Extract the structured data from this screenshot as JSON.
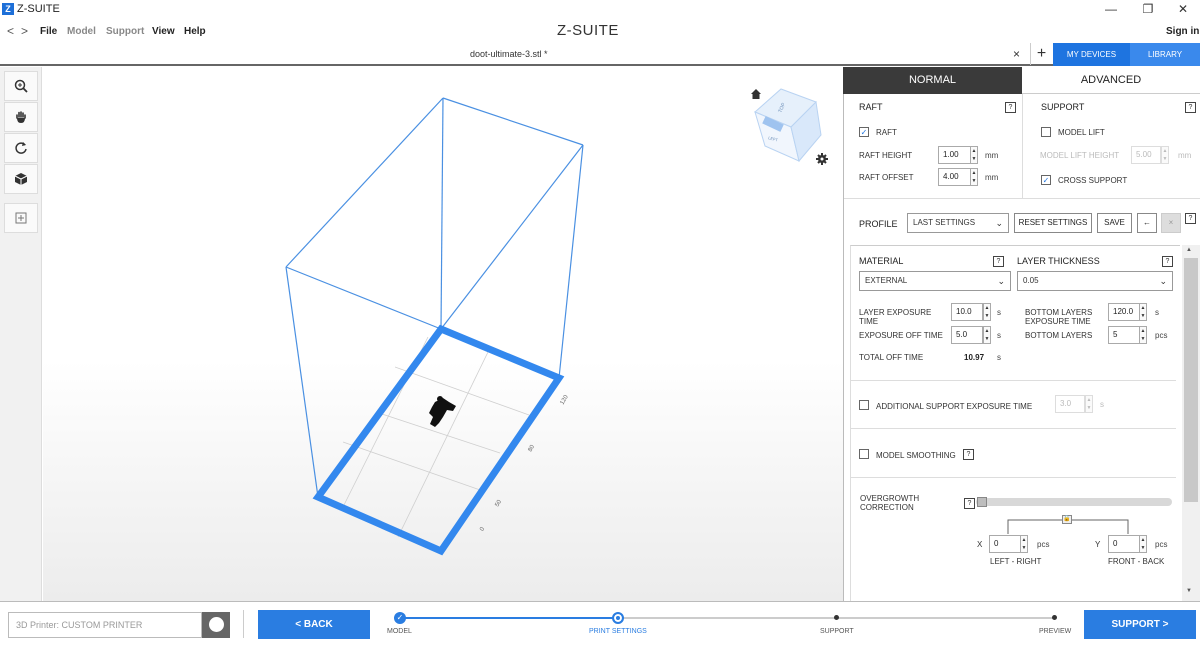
{
  "window": {
    "app_title": "Z-SUITE",
    "logo_letter": "Z",
    "minimize": "—",
    "maximize": "❐",
    "close": "✕"
  },
  "menu": {
    "back": "<",
    "forward": ">",
    "items": [
      "File",
      "Model",
      "Support",
      "View",
      "Help"
    ],
    "brand": "Z-SUITE",
    "sign_in": "Sign in"
  },
  "tabs": {
    "file_name": "doot-ultimate-3.stl *",
    "close": "×",
    "add": "+",
    "my_devices": "MY DEVICES",
    "library": "LIBRARY"
  },
  "toolbar": {
    "icons": [
      "zoom-icon",
      "hand-icon",
      "rotate-icon",
      "cube-icon",
      "add-view-icon"
    ]
  },
  "viewport": {
    "home_icon": "home-icon",
    "settings_icon": "gear-icon",
    "cube_labels": {
      "top": "TOP",
      "left": "LEFT"
    },
    "scale_labels": [
      "0",
      "50",
      "80",
      "120"
    ]
  },
  "panel": {
    "tab_normal": "NORMAL",
    "tab_advanced": "ADVANCED",
    "raft": {
      "title": "RAFT",
      "help": "?",
      "raft_label": "RAFT",
      "raft_checked": true,
      "height_label": "RAFT HEIGHT",
      "height_value": "1.00",
      "height_unit": "mm",
      "offset_label": "RAFT OFFSET",
      "offset_value": "4.00",
      "offset_unit": "mm"
    },
    "support": {
      "title": "SUPPORT",
      "help": "?",
      "model_lift_label": "MODEL LIFT",
      "model_lift_checked": false,
      "lift_height_label": "MODEL LIFT HEIGHT",
      "lift_height_value": "5.00",
      "lift_height_unit": "mm",
      "cross_support_label": "CROSS SUPPORT",
      "cross_support_checked": true
    },
    "profile": {
      "label": "PROFILE",
      "value": "LAST SETTINGS",
      "reset": "RESET SETTINGS",
      "save": "SAVE",
      "undo": "←",
      "delete": "×",
      "help": "?"
    },
    "material": {
      "label": "MATERIAL",
      "value": "EXTERNAL",
      "help": "?"
    },
    "layer_thickness": {
      "label": "LAYER THICKNESS",
      "value": "0.05",
      "help": "?"
    },
    "exposure": {
      "layer_exposure_label": "LAYER EXPOSURE TIME",
      "layer_exposure_value": "10.0",
      "layer_exposure_unit": "s",
      "off_time_label": "EXPOSURE OFF TIME",
      "off_time_value": "5.0",
      "off_time_unit": "s",
      "total_off_label": "TOTAL OFF TIME",
      "total_off_value": "10.97",
      "total_off_unit": "s",
      "bottom_exposure_label": "BOTTOM LAYERS EXPOSURE TIME",
      "bottom_exposure_value": "120.0",
      "bottom_exposure_unit": "s",
      "bottom_layers_label": "BOTTOM LAYERS",
      "bottom_layers_value": "5",
      "bottom_layers_unit": "pcs"
    },
    "additional_support": {
      "label": "ADDITIONAL SUPPORT EXPOSURE TIME",
      "checked": false,
      "value": "3.0",
      "unit": "s"
    },
    "smoothing": {
      "label": "MODEL SMOOTHING",
      "checked": false,
      "help": "?"
    },
    "overgrowth": {
      "label": "OVERGROWTH CORRECTION",
      "help": "?",
      "slider_level": 0,
      "x_label": "X",
      "x_value": "0",
      "x_unit": "pcs",
      "x_caption": "LEFT - RIGHT",
      "y_label": "Y",
      "y_value": "0",
      "y_unit": "pcs",
      "y_caption": "FRONT - BACK"
    }
  },
  "bottom": {
    "printer_placeholder": "3D Printer: CUSTOM PRINTER",
    "back": "< BACK",
    "next": "SUPPORT >",
    "steps": [
      {
        "label": "MODEL",
        "state": "done"
      },
      {
        "label": "PRINT SETTINGS",
        "state": "current"
      },
      {
        "label": "SUPPORT",
        "state": "todo"
      },
      {
        "label": "PREVIEW",
        "state": "todo"
      }
    ]
  },
  "colors": {
    "accent": "#2a7de1",
    "dark_tab": "#3a3a3a",
    "platform": "#3388ee"
  }
}
